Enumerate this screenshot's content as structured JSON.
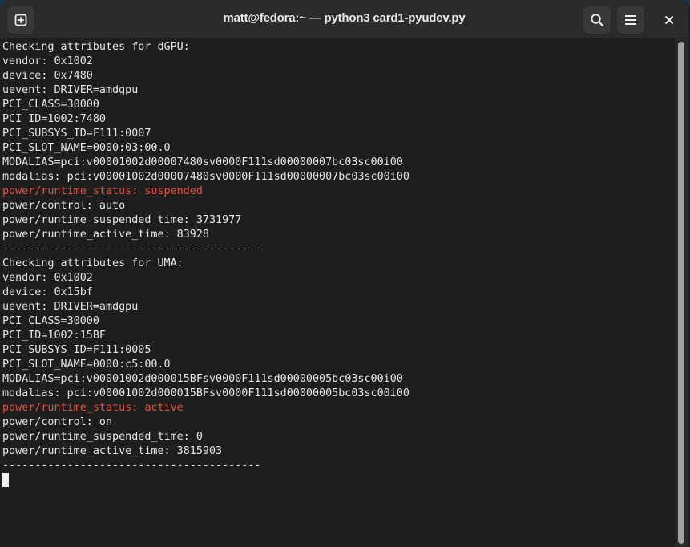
{
  "window": {
    "title": "matt@fedora:~ — python3 card1-pyudev.py"
  },
  "headerbar": {
    "new_tab_icon": "new-tab-plus-icon",
    "search_icon": "search-icon",
    "menu_icon": "hamburger-menu-icon",
    "close_icon": "close-icon"
  },
  "colors": {
    "background": "#1e1e1e",
    "text": "#e6e6e6",
    "highlight": "#e0533f",
    "headerbar": "#2b2b2b"
  },
  "terminal": {
    "lines": [
      {
        "text": "Checking attributes for dGPU:",
        "style": "normal"
      },
      {
        "text": "vendor: 0x1002",
        "style": "normal"
      },
      {
        "text": "device: 0x7480",
        "style": "normal"
      },
      {
        "text": "uevent: DRIVER=amdgpu",
        "style": "normal"
      },
      {
        "text": "PCI_CLASS=30000",
        "style": "normal"
      },
      {
        "text": "PCI_ID=1002:7480",
        "style": "normal"
      },
      {
        "text": "PCI_SUBSYS_ID=F111:0007",
        "style": "normal"
      },
      {
        "text": "PCI_SLOT_NAME=0000:03:00.0",
        "style": "normal"
      },
      {
        "text": "MODALIAS=pci:v00001002d00007480sv0000F111sd00000007bc03sc00i00",
        "style": "normal"
      },
      {
        "text": "modalias: pci:v00001002d00007480sv0000F111sd00000007bc03sc00i00",
        "style": "normal"
      },
      {
        "text": "power/runtime_status: suspended",
        "style": "red"
      },
      {
        "text": "power/control: auto",
        "style": "normal"
      },
      {
        "text": "power/runtime_suspended_time: 3731977",
        "style": "normal"
      },
      {
        "text": "power/runtime_active_time: 83928",
        "style": "normal"
      },
      {
        "text": "----------------------------------------",
        "style": "normal"
      },
      {
        "text": "Checking attributes for UMA:",
        "style": "normal"
      },
      {
        "text": "vendor: 0x1002",
        "style": "normal"
      },
      {
        "text": "device: 0x15bf",
        "style": "normal"
      },
      {
        "text": "uevent: DRIVER=amdgpu",
        "style": "normal"
      },
      {
        "text": "PCI_CLASS=30000",
        "style": "normal"
      },
      {
        "text": "PCI_ID=1002:15BF",
        "style": "normal"
      },
      {
        "text": "PCI_SUBSYS_ID=F111:0005",
        "style": "normal"
      },
      {
        "text": "PCI_SLOT_NAME=0000:c5:00.0",
        "style": "normal"
      },
      {
        "text": "MODALIAS=pci:v00001002d000015BFsv0000F111sd00000005bc03sc00i00",
        "style": "normal"
      },
      {
        "text": "modalias: pci:v00001002d000015BFsv0000F111sd00000005bc03sc00i00",
        "style": "normal"
      },
      {
        "text": "power/runtime_status: active",
        "style": "red"
      },
      {
        "text": "power/control: on",
        "style": "normal"
      },
      {
        "text": "power/runtime_suspended_time: 0",
        "style": "normal"
      },
      {
        "text": "power/runtime_active_time: 3815903",
        "style": "normal"
      },
      {
        "text": "----------------------------------------",
        "style": "normal"
      }
    ]
  },
  "scrollbar": {
    "visible_fraction": 1.0
  }
}
